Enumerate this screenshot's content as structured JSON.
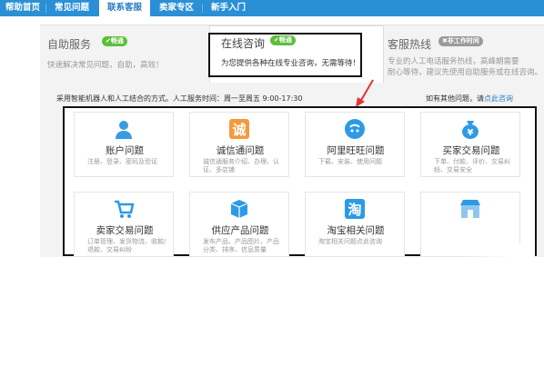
{
  "nav": {
    "tabs": [
      {
        "label": "帮助首页"
      },
      {
        "label": "常见问题"
      },
      {
        "label": "联系客服"
      },
      {
        "label": "卖家专区"
      },
      {
        "label": "新手入门"
      }
    ],
    "active_index": 2
  },
  "services": {
    "self": {
      "title": "自助服务",
      "badge": "✔畅通",
      "desc": "快速解决常见问题，自助，高效！"
    },
    "online": {
      "title": "在线咨询",
      "badge": "✔畅通",
      "desc": "为您提供各种在线专业咨询，无需等待！"
    },
    "hotline": {
      "title": "客服热线",
      "badge": "✖非工作时间",
      "desc_line1": "专业的人工电话服务热线，高峰期需要",
      "desc_line2": "耐心等待，建议先使用自助服务或在线咨询。"
    }
  },
  "info": {
    "text": "采用智能机器人和人工结合的方式。人工服务时间：周一至周五 9:00-17:30",
    "more_prefix": "如有其他问题，请",
    "more_link": "点此咨询"
  },
  "cards": [
    {
      "title": "账户问题",
      "desc": "注册、登录、密码及验证",
      "icon": "user-icon"
    },
    {
      "title": "诚信通问题",
      "desc": "诚信通服务介绍、办理、认证、多店铺",
      "icon": "cheng-icon"
    },
    {
      "title": "阿里旺旺问题",
      "desc": "下载、安装、使用问题",
      "icon": "wangwang-icon"
    },
    {
      "title": "买家交易问题",
      "desc": "下单、付款、评价、交易纠纷、交易安全",
      "icon": "money-bag-icon"
    },
    {
      "title": "卖家交易问题",
      "desc": "订单管理、发货物流、收款/退款、交易纠纷",
      "icon": "cart-icon"
    },
    {
      "title": "供应产品问题",
      "desc": "发布产品、产品图片、产品分类、排序、信息质量",
      "icon": "box-icon"
    },
    {
      "title": "淘宝相关问题",
      "desc": "淘宝相关问题点此咨询",
      "icon": "tao-icon"
    },
    {
      "title": "",
      "desc": "",
      "icon": "shop-icon"
    }
  ],
  "colors": {
    "nav_blue": "#2a8fd5",
    "badge_green": "#5bbf3a",
    "badge_gray": "#9a9a9a",
    "link_blue": "#2a7cc0",
    "annot": "#111111",
    "arrow_red": "#e8312f"
  }
}
